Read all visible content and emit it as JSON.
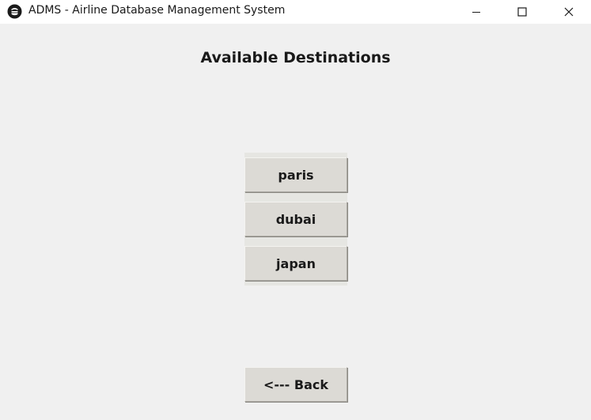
{
  "window": {
    "title": "ADMS - Airline Database Management System",
    "icon": "app-icon"
  },
  "heading": "Available Destinations",
  "destinations": [
    {
      "label": "paris"
    },
    {
      "label": "dubai"
    },
    {
      "label": "japan"
    }
  ],
  "back_button": {
    "label": "<--- Back"
  },
  "colors": {
    "background": "#f0f0f0",
    "titlebar": "#ffffff",
    "button_face": "#dcdad5",
    "text": "#1a1a1a"
  }
}
